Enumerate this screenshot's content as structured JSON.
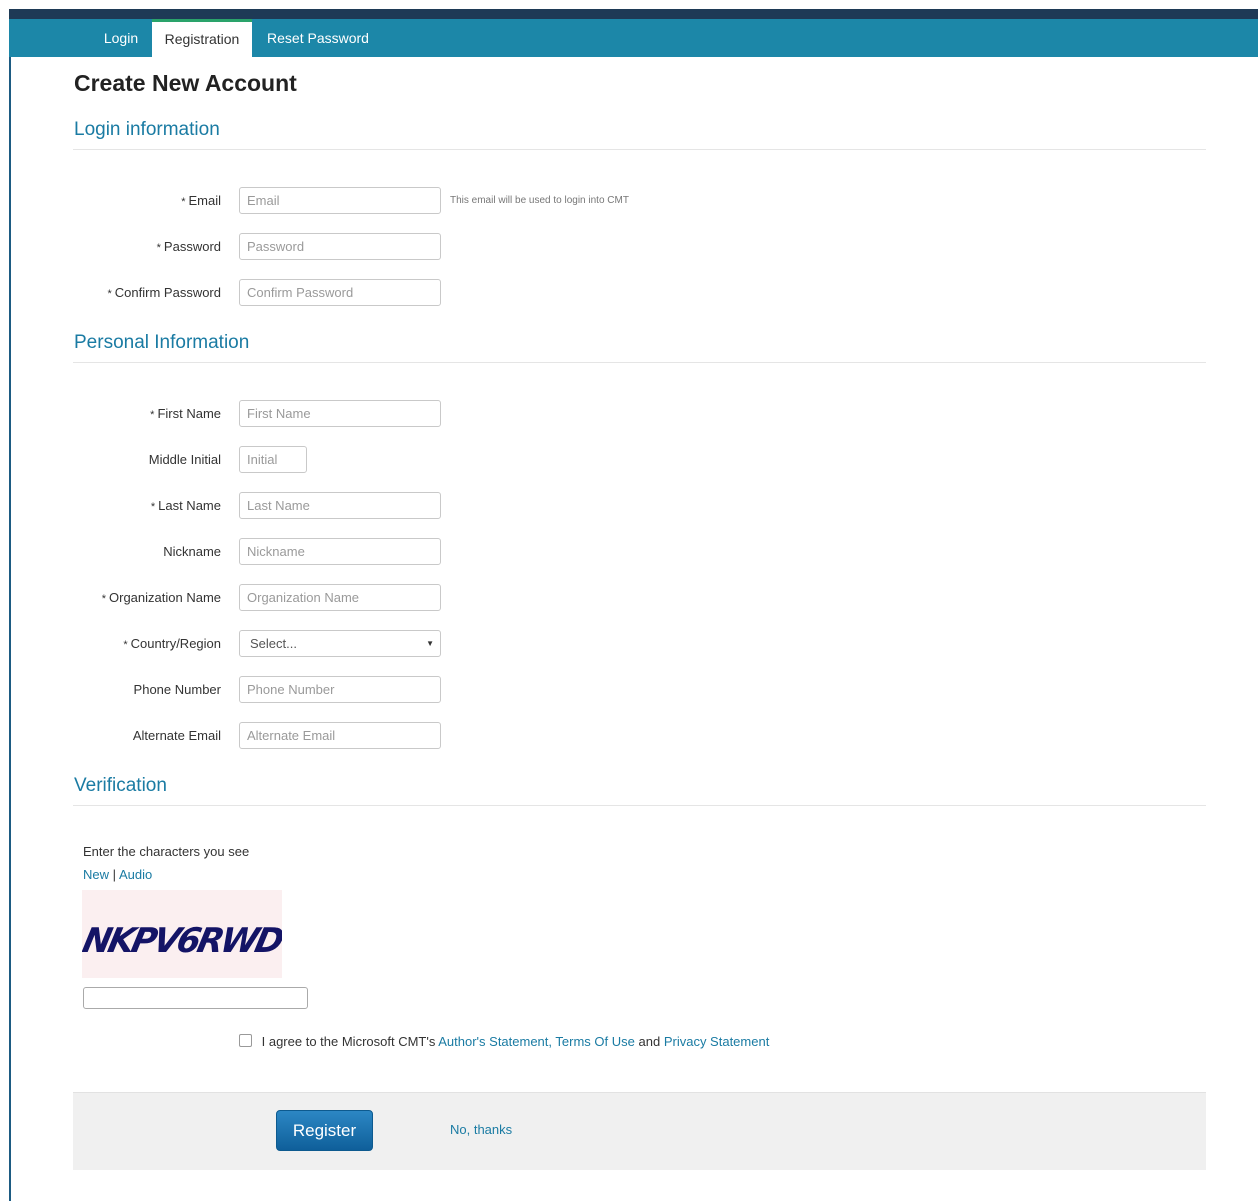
{
  "tabs": {
    "login": "Login",
    "registration": "Registration",
    "reset": "Reset Password"
  },
  "page_title": "Create New Account",
  "sections": {
    "login": "Login information",
    "personal": "Personal Information",
    "verification": "Verification"
  },
  "required_mark": "*",
  "fields": {
    "email": {
      "label": "Email",
      "placeholder": "Email",
      "hint": "This email will be used to login into CMT"
    },
    "password": {
      "label": "Password",
      "placeholder": "Password"
    },
    "confirm_password": {
      "label": "Confirm Password",
      "placeholder": "Confirm Password"
    },
    "first_name": {
      "label": "First Name",
      "placeholder": "First Name"
    },
    "middle_initial": {
      "label": "Middle Initial",
      "placeholder": "Initial"
    },
    "last_name": {
      "label": "Last Name",
      "placeholder": "Last Name"
    },
    "nickname": {
      "label": "Nickname",
      "placeholder": "Nickname"
    },
    "organization": {
      "label": "Organization Name",
      "placeholder": "Organization Name"
    },
    "country": {
      "label": "Country/Region",
      "value": "Select..."
    },
    "phone": {
      "label": "Phone Number",
      "placeholder": "Phone Number"
    },
    "alt_email": {
      "label": "Alternate Email",
      "placeholder": "Alternate Email"
    }
  },
  "captcha": {
    "instruction": "Enter the characters you see",
    "new_link": "New",
    "separator": "|",
    "audio_link": "Audio",
    "image_text": "NKPV6RWD"
  },
  "agreement": {
    "prefix": "I agree to the Microsoft CMT's",
    "authors_statement": "Author's Statement,",
    "terms": "Terms Of Use",
    "and": "and",
    "privacy": "Privacy Statement"
  },
  "buttons": {
    "register": "Register",
    "no_thanks": "No, thanks"
  },
  "colors": {
    "tabbar": "#1c87a8",
    "accent": "#1a7ba3",
    "button": "#1a6fae"
  },
  "icons": {
    "select_caret": "▼"
  }
}
